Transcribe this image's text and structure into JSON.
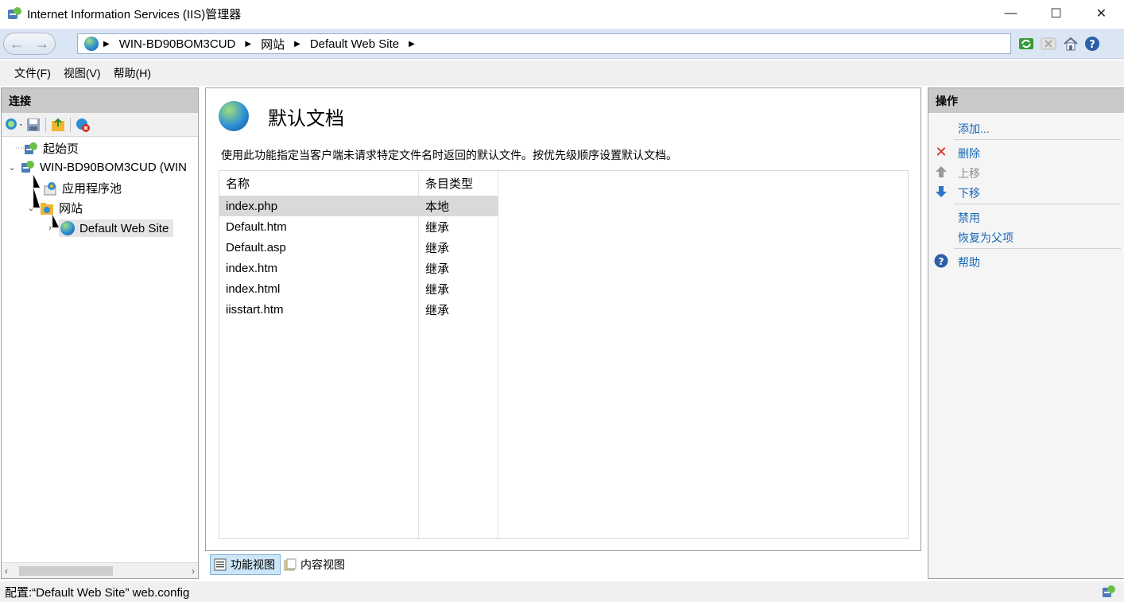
{
  "window": {
    "title": "Internet Information Services (IIS)管理器",
    "minimize": "—",
    "maximize": "☐",
    "close": "✕"
  },
  "address": {
    "segments": [
      "WIN-BD90BOM3CUD",
      "网站",
      "Default Web Site"
    ],
    "back_glyph": "←",
    "forward_glyph": "→"
  },
  "menu": [
    "文件(F)",
    "视图(V)",
    "帮助(H)"
  ],
  "connections": {
    "header": "连接",
    "tree": [
      {
        "label": "起始页",
        "icon": "start-page-icon"
      },
      {
        "label": "WIN-BD90BOM3CUD (WIN",
        "icon": "server-icon"
      },
      {
        "label": "应用程序池",
        "icon": "app-pool-icon"
      },
      {
        "label": "网站",
        "icon": "sites-folder-icon"
      },
      {
        "label": "Default Web Site",
        "icon": "globe-icon"
      }
    ]
  },
  "main": {
    "title": "默认文档",
    "description": "使用此功能指定当客户端未请求特定文件名时返回的默认文件。按优先级顺序设置默认文档。",
    "columns": [
      "名称",
      "条目类型"
    ],
    "rows": [
      {
        "name": "index.php",
        "type": "本地"
      },
      {
        "name": "Default.htm",
        "type": "继承"
      },
      {
        "name": "Default.asp",
        "type": "继承"
      },
      {
        "name": "index.htm",
        "type": "继承"
      },
      {
        "name": "index.html",
        "type": "继承"
      },
      {
        "name": "iisstart.htm",
        "type": "继承"
      }
    ]
  },
  "view_tabs": [
    "功能视图",
    "内容视图"
  ],
  "actions": {
    "header": "操作",
    "items": [
      "添加...",
      "删除",
      "上移",
      "下移",
      "禁用",
      "恢复为父项",
      "帮助"
    ]
  },
  "status": {
    "text": "配置:“Default Web Site” web.config"
  },
  "colors": {
    "link": "#1566b5",
    "selected_row": "#d9d9d9",
    "pane_header": "#c9c9c9",
    "address_bar": "#dbe6f4"
  }
}
